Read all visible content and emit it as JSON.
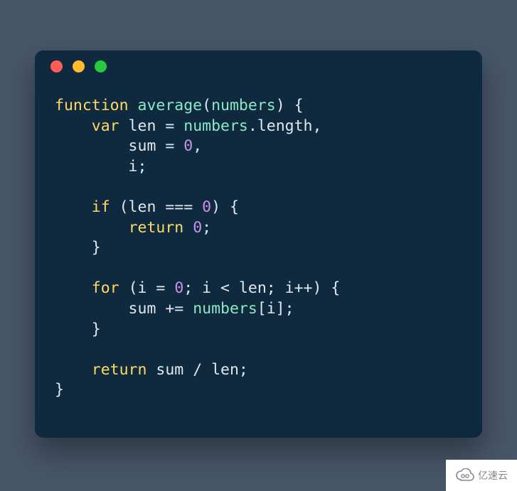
{
  "window": {
    "traffic_lights": [
      "red",
      "yellow",
      "green"
    ]
  },
  "code": {
    "tokens": [
      [
        {
          "t": "function",
          "c": "kw"
        },
        {
          "t": " ",
          "c": "sp"
        },
        {
          "t": "average",
          "c": "fn"
        },
        {
          "t": "(",
          "c": "punc"
        },
        {
          "t": "numbers",
          "c": "prop"
        },
        {
          "t": ") {",
          "c": "punc"
        }
      ],
      [
        {
          "t": "    ",
          "c": "sp"
        },
        {
          "t": "var",
          "c": "kw"
        },
        {
          "t": " len ",
          "c": "id"
        },
        {
          "t": "=",
          "c": "punc"
        },
        {
          "t": " ",
          "c": "sp"
        },
        {
          "t": "numbers",
          "c": "prop"
        },
        {
          "t": ".length,",
          "c": "id"
        }
      ],
      [
        {
          "t": "        sum ",
          "c": "id"
        },
        {
          "t": "=",
          "c": "punc"
        },
        {
          "t": " ",
          "c": "sp"
        },
        {
          "t": "0",
          "c": "num"
        },
        {
          "t": ",",
          "c": "punc"
        }
      ],
      [
        {
          "t": "        i;",
          "c": "id"
        }
      ],
      [
        {
          "t": "",
          "c": "sp"
        }
      ],
      [
        {
          "t": "    ",
          "c": "sp"
        },
        {
          "t": "if",
          "c": "kw"
        },
        {
          "t": " (len ",
          "c": "id"
        },
        {
          "t": "===",
          "c": "punc"
        },
        {
          "t": " ",
          "c": "sp"
        },
        {
          "t": "0",
          "c": "num"
        },
        {
          "t": ") {",
          "c": "punc"
        }
      ],
      [
        {
          "t": "        ",
          "c": "sp"
        },
        {
          "t": "return",
          "c": "kw"
        },
        {
          "t": " ",
          "c": "sp"
        },
        {
          "t": "0",
          "c": "num"
        },
        {
          "t": ";",
          "c": "punc"
        }
      ],
      [
        {
          "t": "    }",
          "c": "punc"
        }
      ],
      [
        {
          "t": "",
          "c": "sp"
        }
      ],
      [
        {
          "t": "    ",
          "c": "sp"
        },
        {
          "t": "for",
          "c": "kw"
        },
        {
          "t": " (i ",
          "c": "id"
        },
        {
          "t": "=",
          "c": "punc"
        },
        {
          "t": " ",
          "c": "sp"
        },
        {
          "t": "0",
          "c": "num"
        },
        {
          "t": "; i ",
          "c": "id"
        },
        {
          "t": "<",
          "c": "punc"
        },
        {
          "t": " len; i",
          "c": "id"
        },
        {
          "t": "++",
          "c": "punc"
        },
        {
          "t": ") {",
          "c": "punc"
        }
      ],
      [
        {
          "t": "        sum ",
          "c": "id"
        },
        {
          "t": "+=",
          "c": "punc"
        },
        {
          "t": " ",
          "c": "sp"
        },
        {
          "t": "numbers",
          "c": "prop"
        },
        {
          "t": "[i];",
          "c": "id"
        }
      ],
      [
        {
          "t": "    }",
          "c": "punc"
        }
      ],
      [
        {
          "t": "",
          "c": "sp"
        }
      ],
      [
        {
          "t": "    ",
          "c": "sp"
        },
        {
          "t": "return",
          "c": "kw"
        },
        {
          "t": " sum ",
          "c": "id"
        },
        {
          "t": "/",
          "c": "punc"
        },
        {
          "t": " len;",
          "c": "id"
        }
      ],
      [
        {
          "t": "}",
          "c": "punc"
        }
      ]
    ]
  },
  "watermark": {
    "text": "亿速云"
  }
}
